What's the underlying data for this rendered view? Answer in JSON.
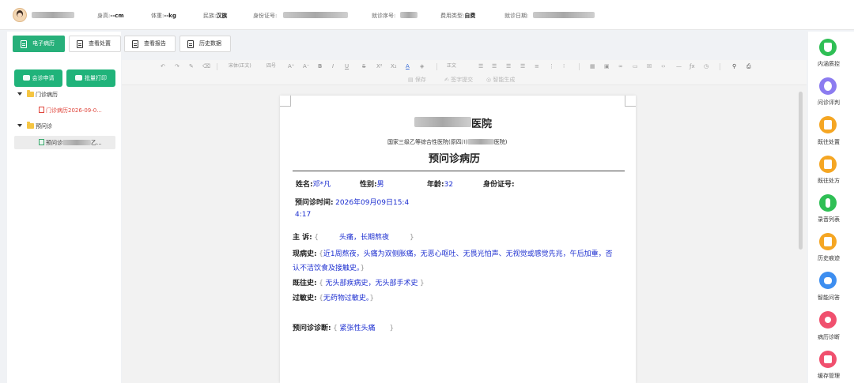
{
  "patient_bar": {
    "height_label": "身高:",
    "height_value": "--cm",
    "weight_label": "体重:",
    "weight_value": "--kg",
    "ethnicity_label": "民族:",
    "ethnicity_value": "汉族",
    "id_label": "身份证号:",
    "visit_no_label": "就诊序号:",
    "fee_type_label": "费用类型:",
    "fee_type_value": "自费",
    "visit_date_label": "就诊日期:"
  },
  "tabs": [
    {
      "label": "电子病历",
      "active": true
    },
    {
      "label": "查看处置",
      "active": false
    },
    {
      "label": "查看报告",
      "active": false
    },
    {
      "label": "历史数据",
      "active": false
    }
  ],
  "actions": {
    "consult_label": "会诊申请",
    "batch_print_label": "批量打印"
  },
  "tree": {
    "group1_label": "门诊病历",
    "group1_item": "门诊病历2026-09-0...",
    "group2_label": "预问诊",
    "group2_item_prefix": "预问诊",
    "group2_item_suffix": "乙..."
  },
  "toolbar": {
    "font_family": "宋体(正文)",
    "font_size": "四号",
    "para_style": "正文",
    "save_label": "保存",
    "sign_label": "签字提交",
    "smart_gen_label": "智能生成"
  },
  "document": {
    "hospital_suffix": "医院",
    "hospital_subtitle_prefix": "国家三级乙等综合性医院(原四川",
    "hospital_subtitle_suffix": "医院)",
    "title": "预问诊病历",
    "name_label": "姓名:",
    "name_value": "邓*凡",
    "gender_label": "性别:",
    "gender_value": "男",
    "age_label": "年龄:",
    "age_value": "32",
    "id_label": "身份证号:",
    "time_label": "预问诊时间:",
    "time_value_line1": "2026年09月09日15:4",
    "time_value_line2": "4:17",
    "chief_label": "主      诉:",
    "chief_value": "头痛，长期熬夜",
    "present_label": "现病史:",
    "present_value_line1": "近1周熬夜，头痛为双侧胀痛，无恶心呕吐、无畏光怕声、无视觉或感觉先兆，午后加重，否",
    "present_value_line2": "认不洁饮食及接触史。",
    "past_label": "既往史:",
    "past_value": "无头部疾病史，无头部手术史",
    "allergy_label": "过敏史:",
    "allergy_value": "无药物过敏史。",
    "diag_label": "预问诊诊断:",
    "diag_value": "紧张性头痛"
  },
  "sidebar": {
    "items": [
      {
        "label": "内涵质控",
        "color": "#2fbf55",
        "icon": "shield-check-icon"
      },
      {
        "label": "问诊评判",
        "color": "#8c7cf0",
        "icon": "star-icon"
      },
      {
        "label": "既往处置",
        "color": "#f5a623",
        "icon": "clipboard-icon"
      },
      {
        "label": "既往处方",
        "color": "#f5a623",
        "icon": "prescription-icon"
      },
      {
        "label": "录音列表",
        "color": "#2fbf55",
        "icon": "microphone-icon"
      },
      {
        "label": "历史痕迹",
        "color": "#f5a623",
        "icon": "history-doc-icon"
      },
      {
        "label": "智能问答",
        "color": "#3d8ef0",
        "icon": "robot-icon"
      },
      {
        "label": "病历诊断",
        "color": "#f0506e",
        "icon": "stethoscope-icon"
      },
      {
        "label": "缓存管理",
        "color": "#f0506e",
        "icon": "cache-icon"
      }
    ]
  }
}
